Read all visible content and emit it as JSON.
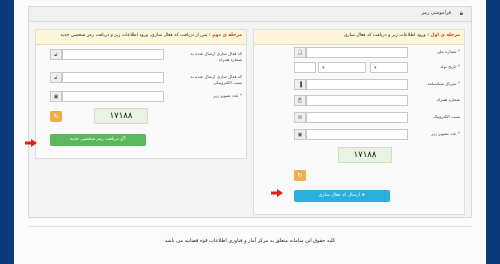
{
  "panel": {
    "title": "فراموشی رمز"
  },
  "right_column": {
    "step_label": "مرحله ی اول :",
    "step_text": "ورود اطلاعات زیر و دریافت کد فعال سازی",
    "fields": [
      {
        "label": "شماره ملی",
        "icon": "user-icon"
      },
      {
        "label": "تاریخ تولد",
        "icon": "calendar"
      },
      {
        "label": "سریال شناسنامه",
        "icon": "barcode-icon"
      },
      {
        "label": "شماره همراه",
        "icon": "phone-icon"
      },
      {
        "label": "پست الکترونیک",
        "icon": "envelope-icon"
      },
      {
        "label": "عدد تصویر زیر",
        "icon": "image-icon"
      }
    ],
    "captcha_text": "۱۷۱۸۸",
    "submit_label": "ارسال کد فعال سازی"
  },
  "left_column": {
    "step_label": "مرحله ی دوم :",
    "step_text": "پس از دریافت کد فعال سازی، ورود اطلاعات زیر و دریافت رمز شخصی جدید",
    "fields": [
      {
        "label": "کد فعال سازی ارسال شده به شماره همراه",
        "icon": "unlock-icon"
      },
      {
        "label": "کد فعال سازی ارسال شده به پست الکترونیکی",
        "icon": "unlock-icon"
      },
      {
        "label": "عدد تصویر زیر",
        "icon": "image-icon"
      }
    ],
    "captcha_text": "۱۷۱۸۸",
    "submit_label": "دریافت رمز شخصی جدید"
  },
  "footer": {
    "text": "کلیه حقوق این سامانه متعلق به مرکز آمار و فناوری اطلاعات قوه قضاییه می باشد"
  },
  "colors": {
    "accent_blue": "#2bb0dd",
    "accent_green": "#5cb85c",
    "step_red": "#c0392b",
    "arrow_red": "#e0201b",
    "header_navy": "#0d3a7a"
  }
}
